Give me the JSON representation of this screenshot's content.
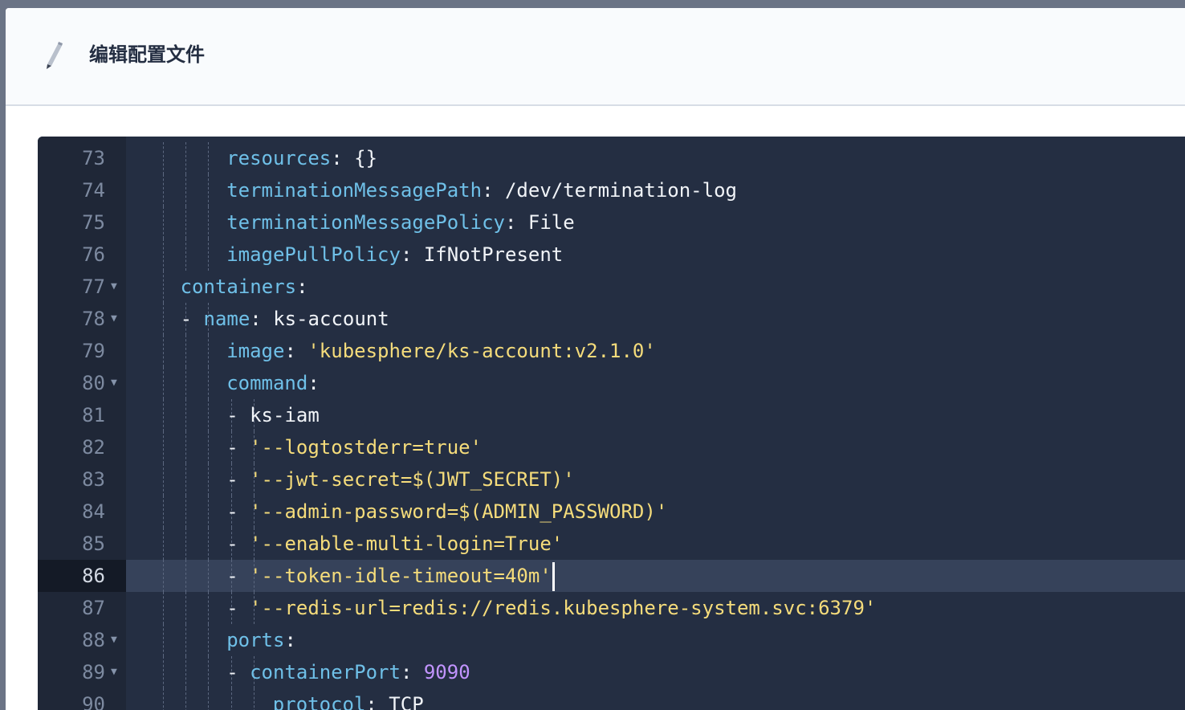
{
  "dialog": {
    "title": "编辑配置文件",
    "icon": "pencil-icon"
  },
  "editor": {
    "language": "yaml",
    "theme": {
      "background": "#242e42",
      "key": "#6fc0e8",
      "string": "#f5dc7b",
      "number": "#c294ff",
      "text": "#f1f4f8"
    },
    "active_line": "86",
    "lines": [
      {
        "num": "73",
        "fold": false,
        "indent": 4,
        "dash": false,
        "key": "resources",
        "sep": ": ",
        "value": "{}",
        "vtype": "plain"
      },
      {
        "num": "74",
        "fold": false,
        "indent": 4,
        "dash": false,
        "key": "terminationMessagePath",
        "sep": ": ",
        "value": "/dev/termination-log",
        "vtype": "plain"
      },
      {
        "num": "75",
        "fold": false,
        "indent": 4,
        "dash": false,
        "key": "terminationMessagePolicy",
        "sep": ": ",
        "value": "File",
        "vtype": "plain"
      },
      {
        "num": "76",
        "fold": false,
        "indent": 4,
        "dash": false,
        "key": "imagePullPolicy",
        "sep": ": ",
        "value": "IfNotPresent",
        "vtype": "plain"
      },
      {
        "num": "77",
        "fold": true,
        "indent": 2,
        "dash": false,
        "key": "containers",
        "sep": ":",
        "value": "",
        "vtype": "plain"
      },
      {
        "num": "78",
        "fold": true,
        "indent": 3,
        "dash": true,
        "key": "name",
        "sep": ": ",
        "value": "ks-account",
        "vtype": "plain"
      },
      {
        "num": "79",
        "fold": false,
        "indent": 4,
        "dash": false,
        "key": "image",
        "sep": ": ",
        "value": "'kubesphere/ks-account:v2.1.0'",
        "vtype": "string"
      },
      {
        "num": "80",
        "fold": true,
        "indent": 4,
        "dash": false,
        "key": "command",
        "sep": ":",
        "value": "",
        "vtype": "plain"
      },
      {
        "num": "81",
        "fold": false,
        "indent": 5,
        "dash": true,
        "key": "",
        "sep": "",
        "value": "ks-iam",
        "vtype": "plain"
      },
      {
        "num": "82",
        "fold": false,
        "indent": 5,
        "dash": true,
        "key": "",
        "sep": "",
        "value": "'--logtostderr=true'",
        "vtype": "string"
      },
      {
        "num": "83",
        "fold": false,
        "indent": 5,
        "dash": true,
        "key": "",
        "sep": "",
        "value": "'--jwt-secret=$(JWT_SECRET)'",
        "vtype": "string"
      },
      {
        "num": "84",
        "fold": false,
        "indent": 5,
        "dash": true,
        "key": "",
        "sep": "",
        "value": "'--admin-password=$(ADMIN_PASSWORD)'",
        "vtype": "string"
      },
      {
        "num": "85",
        "fold": false,
        "indent": 5,
        "dash": true,
        "key": "",
        "sep": "",
        "value": "'--enable-multi-login=True'",
        "vtype": "string"
      },
      {
        "num": "86",
        "fold": false,
        "indent": 5,
        "dash": true,
        "key": "",
        "sep": "",
        "value": "'--token-idle-timeout=40m'",
        "vtype": "string"
      },
      {
        "num": "87",
        "fold": false,
        "indent": 5,
        "dash": true,
        "key": "",
        "sep": "",
        "value": "'--redis-url=redis://redis.kubesphere-system.svc:6379'",
        "vtype": "string"
      },
      {
        "num": "88",
        "fold": true,
        "indent": 4,
        "dash": false,
        "key": "ports",
        "sep": ":",
        "value": "",
        "vtype": "plain"
      },
      {
        "num": "89",
        "fold": true,
        "indent": 5,
        "dash": true,
        "key": "containerPort",
        "sep": ": ",
        "value": "9090",
        "vtype": "number"
      },
      {
        "num": "90",
        "fold": false,
        "indent": 6,
        "dash": false,
        "key": "protocol",
        "sep": ": ",
        "value": "TCP",
        "vtype": "plain"
      }
    ]
  }
}
